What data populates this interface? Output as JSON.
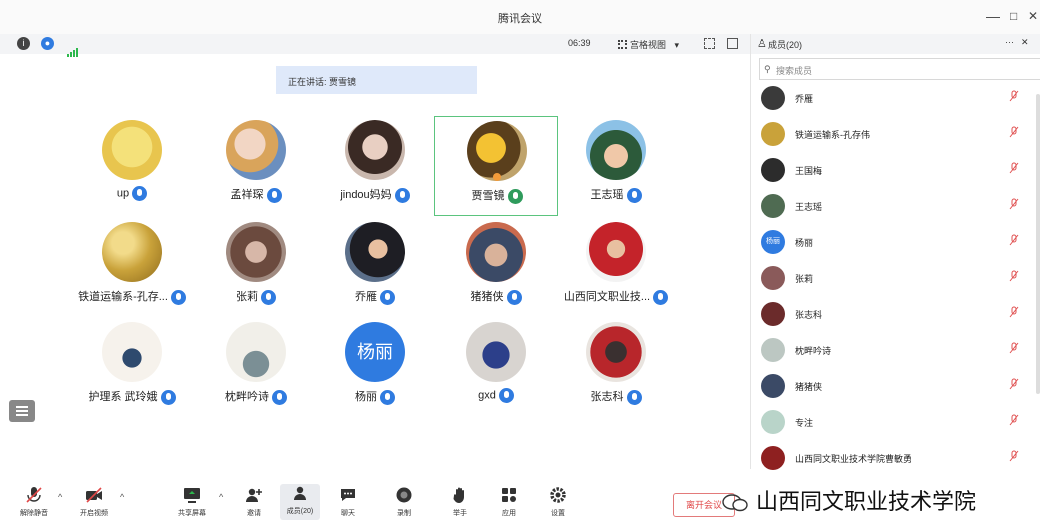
{
  "window": {
    "title": "腾讯会议",
    "minimize": "—",
    "maximize": "□",
    "close": "✕"
  },
  "toolbar": {
    "info_icon": "info-icon",
    "shield_icon": "shield-icon",
    "timer": "06:39",
    "view_mode": "宫格视图",
    "view_mode_caret": "▾",
    "fullscreen_icon": "fullscreen-icon",
    "layout_icon": "layout-icon"
  },
  "speaking_banner": "正在讲话: 贾雪镜",
  "grid": [
    {
      "name": "up",
      "avatar": "sponge-cartoon",
      "mic_color": "blue",
      "active": false
    },
    {
      "name": "孟祥琛",
      "avatar": "cartoon-baby",
      "mic_color": "blue",
      "active": false
    },
    {
      "name": "jindou妈妈",
      "avatar": "woman-photo",
      "mic_color": "blue",
      "active": false
    },
    {
      "name": "贾雪镜",
      "avatar": "food-photo",
      "mic_color": "green",
      "active": true
    },
    {
      "name": "王志瑶",
      "avatar": "couple-cartoon",
      "mic_color": "blue",
      "active": false
    },
    {
      "name": "铁道运输系-孔存...",
      "avatar": "gold-gradient",
      "mic_color": "blue",
      "active": false
    },
    {
      "name": "张莉",
      "avatar": "group-photo",
      "mic_color": "blue",
      "active": false
    },
    {
      "name": "乔雁",
      "avatar": "woman-dark-photo",
      "mic_color": "blue",
      "active": false
    },
    {
      "name": "猪猪侠",
      "avatar": "people-photo",
      "mic_color": "blue",
      "active": false
    },
    {
      "name": "山西同文职业技...",
      "avatar": "red-photo",
      "mic_color": "blue",
      "active": false
    },
    {
      "name": "护理系 武玲娥",
      "avatar": "ink-painting",
      "mic_color": "blue",
      "active": false
    },
    {
      "name": "枕畔吟诗",
      "avatar": "ink-landscape",
      "mic_color": "blue",
      "active": false
    },
    {
      "name": "杨丽",
      "avatar": "text-avatar",
      "avatar_text": "杨丽",
      "mic_color": "blue",
      "active": false
    },
    {
      "name": "gxd",
      "avatar": "blueberry-photo",
      "mic_color": "blue",
      "active": false
    },
    {
      "name": "张志科",
      "avatar": "festival-photo",
      "mic_color": "blue",
      "active": false
    }
  ],
  "sidebar": {
    "header": "成员(20)",
    "more": "···",
    "close": "✕",
    "search_placeholder": "搜索成员",
    "members": [
      {
        "name": "乔雁",
        "avatar_color": "#3a3a3a",
        "mic": "muted"
      },
      {
        "name": "铁道运输系-孔存伟",
        "avatar_color": "#c9a23a",
        "mic": "muted"
      },
      {
        "name": "王国梅",
        "avatar_color": "#2c2c2c",
        "mic": "muted"
      },
      {
        "name": "王志瑶",
        "avatar_color": "#4f6b52",
        "mic": "muted"
      },
      {
        "name": "杨丽",
        "avatar_color": "#2f7be0",
        "avatar_text": "杨丽",
        "mic": "muted"
      },
      {
        "name": "张莉",
        "avatar_color": "#8a5a5a",
        "mic": "muted"
      },
      {
        "name": "张志科",
        "avatar_color": "#6b2b2b",
        "mic": "muted"
      },
      {
        "name": "枕畔吟诗",
        "avatar_color": "#bcc7c2",
        "mic": "muted"
      },
      {
        "name": "猪猪侠",
        "avatar_color": "#3b4a66",
        "mic": "muted"
      },
      {
        "name": "专注",
        "avatar_color": "#b9d4c9",
        "mic": "muted"
      },
      {
        "name": "山西同文职业技术学院曹敏勇",
        "avatar_color": "#8e2020",
        "mic": "muted"
      }
    ]
  },
  "bottom": {
    "buttons": [
      {
        "key": "mute",
        "label": "解除静音",
        "icon": "mic-off-icon"
      },
      {
        "key": "video",
        "label": "开启视频",
        "icon": "camera-off-icon"
      },
      {
        "key": "share",
        "label": "共享屏幕",
        "icon": "screen-share-icon"
      },
      {
        "key": "invite",
        "label": "邀请",
        "icon": "add-user-icon"
      },
      {
        "key": "members",
        "label": "成员(20)",
        "icon": "members-icon"
      },
      {
        "key": "chat",
        "label": "聊天",
        "icon": "chat-icon"
      },
      {
        "key": "record",
        "label": "录制",
        "icon": "record-icon"
      },
      {
        "key": "hand",
        "label": "举手",
        "icon": "hand-icon"
      },
      {
        "key": "apps",
        "label": "应用",
        "icon": "apps-icon"
      },
      {
        "key": "settings",
        "label": "设置",
        "icon": "gear-icon"
      }
    ],
    "caret": "^",
    "leave_label": "离开会议",
    "watermark": "山西同文职业技术学院"
  },
  "colors": {
    "accent": "#2f7be0",
    "active_border": "#5bc47e",
    "leave": "#e04848",
    "banner": "#dfe9fa"
  }
}
